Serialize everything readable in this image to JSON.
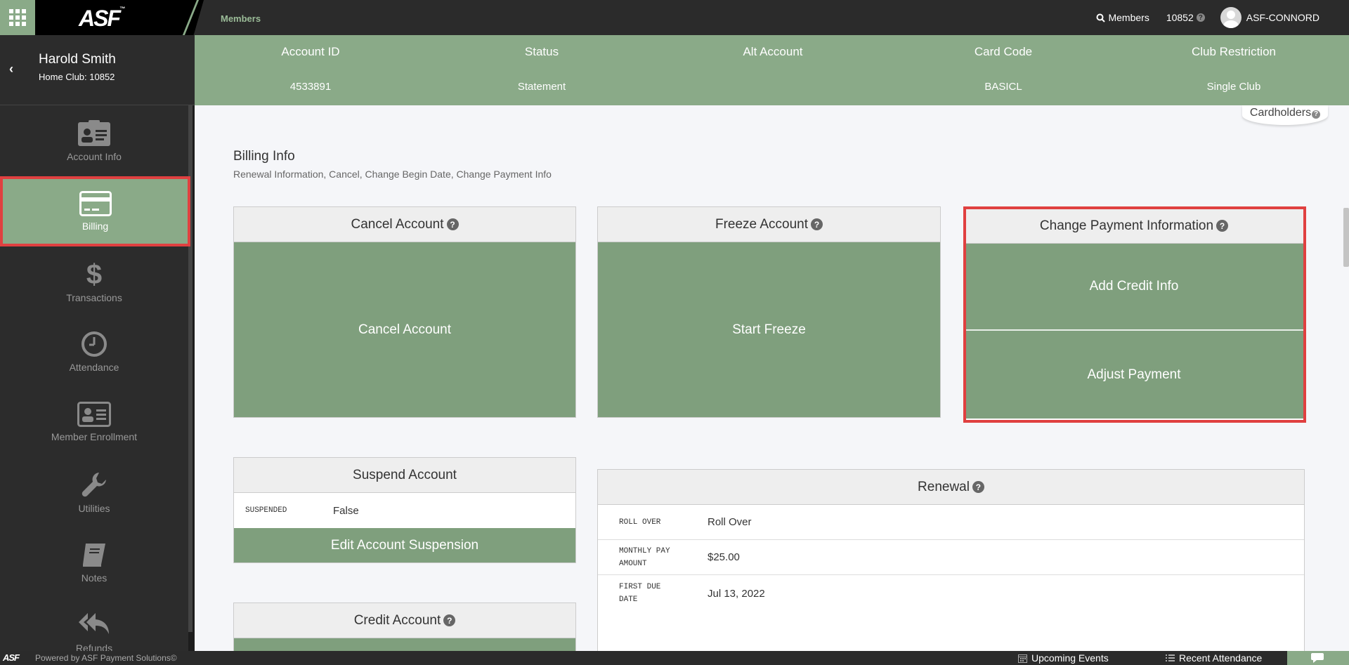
{
  "topbar": {
    "brand": "ASF",
    "brand_tm": "™",
    "breadcrumb": "Members",
    "search_label": "Members",
    "club_number": "10852",
    "user_name": "ASF-CONNORD"
  },
  "member": {
    "name": "Harold Smith",
    "home_club": "Home Club: 10852"
  },
  "sidebar": {
    "items": [
      {
        "label": "Account Info",
        "icon": "id-card-icon"
      },
      {
        "label": "Billing",
        "icon": "credit-card-icon"
      },
      {
        "label": "Transactions",
        "icon": "dollar-icon"
      },
      {
        "label": "Attendance",
        "icon": "clock-icon"
      },
      {
        "label": "Member Enrollment",
        "icon": "enrollment-card-icon"
      },
      {
        "label": "Utilities",
        "icon": "wrench-icon"
      },
      {
        "label": "Notes",
        "icon": "book-icon"
      },
      {
        "label": "Refunds",
        "icon": "reply-all-icon"
      }
    ],
    "active": "Billing"
  },
  "account_summary": {
    "columns": [
      {
        "label": "Account ID",
        "value": "4533891"
      },
      {
        "label": "Status",
        "value": "Statement"
      },
      {
        "label": "Alt Account",
        "value": ""
      },
      {
        "label": "Card Code",
        "value": "BASICL"
      },
      {
        "label": "Club Restriction",
        "value": "Single Club"
      }
    ]
  },
  "cardholders_label": "Cardholders",
  "billing": {
    "title": "Billing Info",
    "subtitle": "Renewal Information, Cancel, Change Begin Date, Change Payment Info"
  },
  "panels": {
    "cancel": {
      "title": "Cancel Account",
      "button": "Cancel Account"
    },
    "freeze": {
      "title": "Freeze Account",
      "button": "Start Freeze"
    },
    "payment": {
      "title": "Change Payment Information",
      "add_credit": "Add Credit Info",
      "adjust": "Adjust Payment"
    },
    "suspend": {
      "title": "Suspend Account",
      "key": "SUSPENDED",
      "value": "False",
      "button": "Edit Account Suspension"
    },
    "credit": {
      "title": "Credit Account"
    },
    "renewal": {
      "title": "Renewal",
      "rows": [
        {
          "key_line1": "ROLL OVER",
          "key_line2": "",
          "value": "Roll Over"
        },
        {
          "key_line1": "MONTHLY PAY",
          "key_line2": "AMOUNT",
          "value": "$25.00"
        },
        {
          "key_line1": "FIRST DUE",
          "key_line2": "DATE",
          "value": "Jul 13, 2022"
        }
      ]
    }
  },
  "footer": {
    "brand": "ASF",
    "powered_by": "Powered by ASF Payment Solutions©",
    "upcoming_events": "Upcoming Events",
    "recent_attendance": "Recent Attendance"
  },
  "colors": {
    "accent_green": "#8aaa88",
    "button_green": "#7f9f7d",
    "highlight_red": "#e04040",
    "dark": "#2b2b2b"
  }
}
